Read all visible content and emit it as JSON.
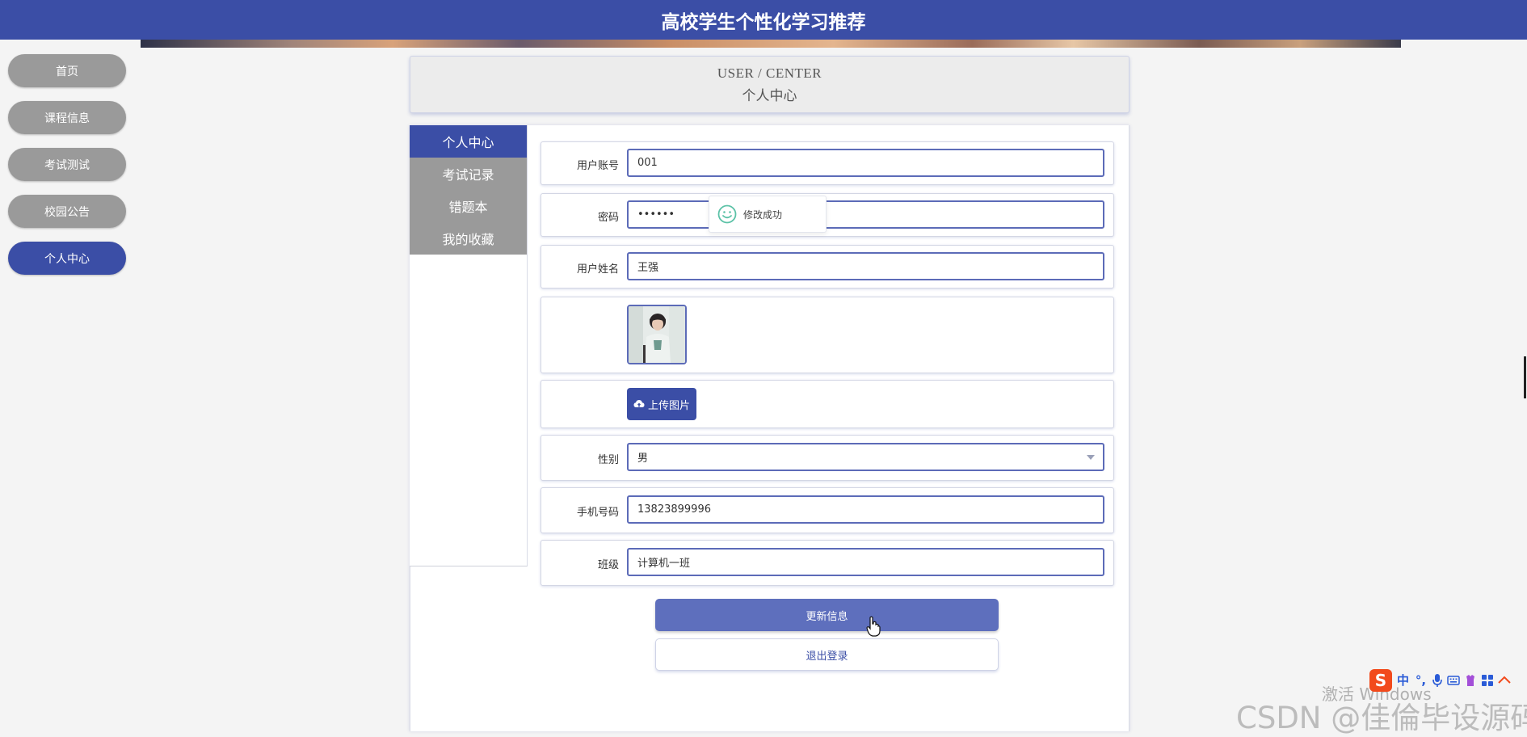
{
  "header": {
    "title": "高校学生个性化学习推荐"
  },
  "sidebar": {
    "items": [
      {
        "label": "首页"
      },
      {
        "label": "课程信息"
      },
      {
        "label": "考试测试"
      },
      {
        "label": "校园公告"
      },
      {
        "label": "个人中心",
        "active": true
      }
    ]
  },
  "page_title": {
    "en": "USER / CENTER",
    "cn": "个人中心"
  },
  "user_menu": {
    "items": [
      {
        "label": "个人中心",
        "active": true
      },
      {
        "label": "考试记录"
      },
      {
        "label": "错题本"
      },
      {
        "label": "我的收藏"
      }
    ]
  },
  "form": {
    "account": {
      "label": "用户账号",
      "value": "001"
    },
    "password": {
      "label": "密码",
      "value": "••••••"
    },
    "name": {
      "label": "用户姓名",
      "value": "王强"
    },
    "upload": {
      "label": "上传图片",
      "icon": "cloud-upload-icon"
    },
    "gender": {
      "label": "性别",
      "value": "男"
    },
    "phone": {
      "label": "手机号码",
      "value": "13823899996"
    },
    "class": {
      "label": "班级",
      "value": "计算机一班"
    }
  },
  "toast": {
    "message": "修改成功",
    "icon": "smile-icon"
  },
  "buttons": {
    "update": "更新信息",
    "logout": "退出登录"
  },
  "watermarks": {
    "windows": "激活 Windows",
    "csdn": "CSDN @佳倫毕设源码"
  },
  "tray": {
    "ime_logo": "S",
    "ime_mode": "中",
    "punct": "°,"
  },
  "colors": {
    "primary": "#3b4ea6",
    "nav_inactive": "#9a9a9a",
    "update_button": "#5e6fbd"
  }
}
